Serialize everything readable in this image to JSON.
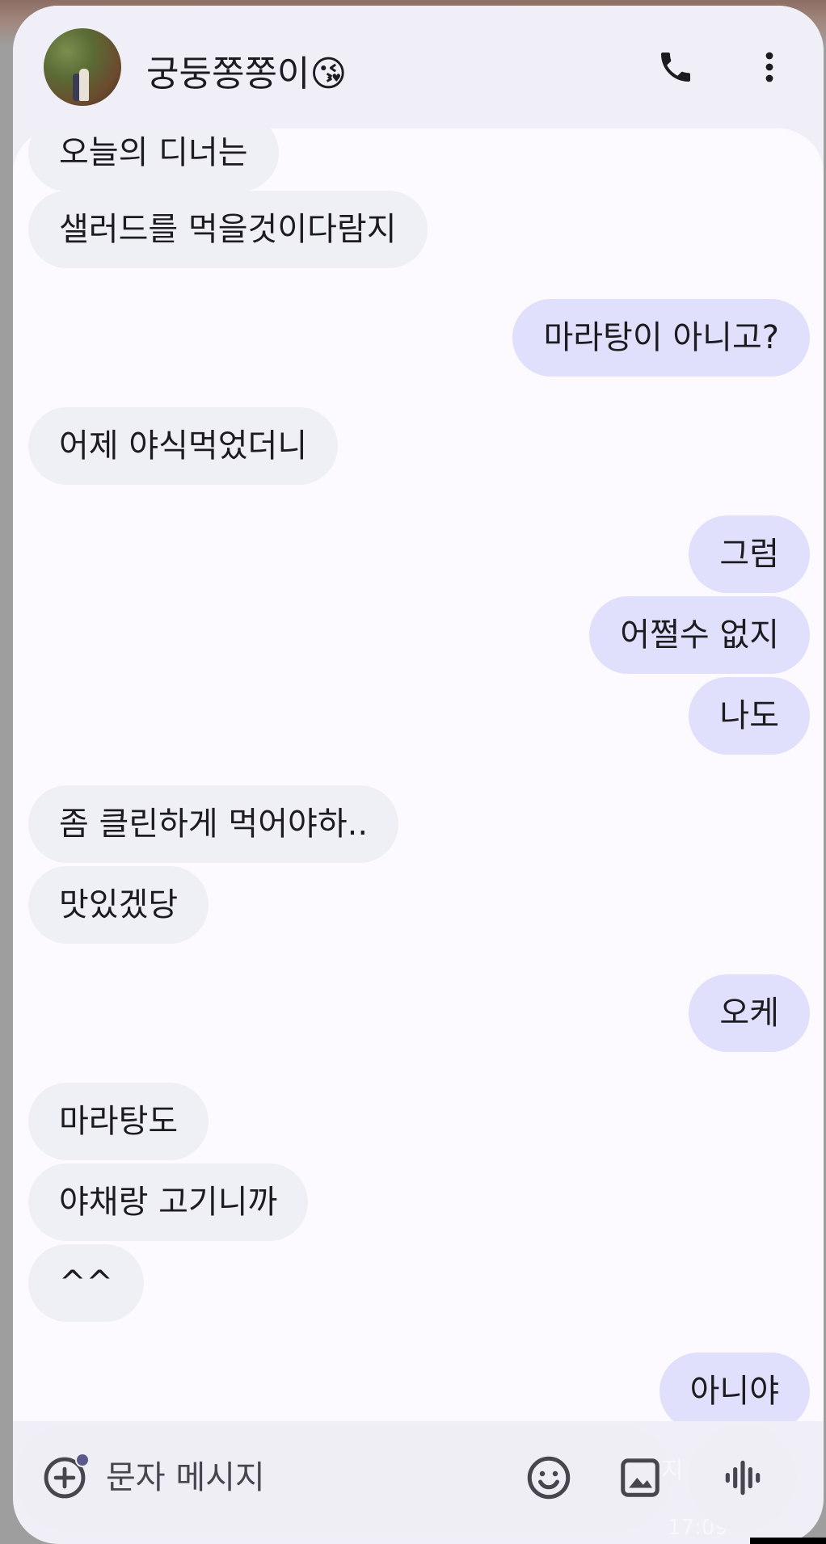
{
  "header": {
    "contact_name": "궁둥쫑쫑이😘",
    "call_icon": "phone-icon",
    "more_icon": "more-vert-icon"
  },
  "messages": [
    {
      "dir": "in",
      "text": "오늘의 디너는"
    },
    {
      "dir": "in",
      "text": "샐러드를 먹을것이다람지"
    },
    {
      "dir": "out",
      "text": "마라탕이 아니고?"
    },
    {
      "dir": "in",
      "text": "어제 야식먹었더니"
    },
    {
      "dir": "out",
      "text": "그럼"
    },
    {
      "dir": "out",
      "text": "어쩔수 없지"
    },
    {
      "dir": "out",
      "text": "나도"
    },
    {
      "dir": "in",
      "text": "좀 클린하게 먹어야하.."
    },
    {
      "dir": "in",
      "text": "맛있겠당"
    },
    {
      "dir": "out",
      "text": "오케"
    },
    {
      "dir": "in",
      "text": "마라탕도"
    },
    {
      "dir": "in",
      "text": "야채랑 고기니까"
    },
    {
      "dir": "in",
      "text": "^^"
    },
    {
      "dir": "out",
      "text": "아니야"
    }
  ],
  "composer": {
    "placeholder": "문자 메시지",
    "add_icon": "add-circle-icon",
    "emoji_icon": "emoji-icon",
    "gallery_icon": "image-icon",
    "voice_icon": "voice-waveform-icon"
  },
  "ghost": {
    "text": "지",
    "time": "17:09"
  },
  "colors": {
    "incoming_bubble": "#efeff6",
    "outgoing_bubble": "#e1e0fc",
    "chat_background": "#fcfaff",
    "header_background": "#f0eff7"
  }
}
